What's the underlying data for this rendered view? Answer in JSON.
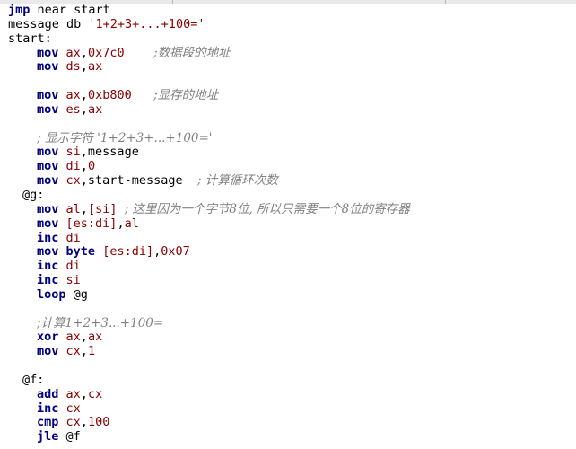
{
  "code": {
    "l1": {
      "kw": "jmp",
      "rest": " near start"
    },
    "l2": {
      "a": "message db ",
      "str": "'1+2+3+...+100='"
    },
    "l3": {
      "label": "start:"
    },
    "l4": {
      "kw": "mov",
      "sp": " ",
      "reg": "ax",
      "sep": ",",
      "num": "0x7c0",
      "gap": "    ",
      "cmt": ";数据段的地址"
    },
    "l5": {
      "kw": "mov",
      "sp": " ",
      "reg1": "ds",
      "sep": ",",
      "reg2": "ax"
    },
    "l7": {
      "kw": "mov",
      "sp": " ",
      "reg": "ax",
      "sep": ",",
      "num": "0xb800",
      "gap": "   ",
      "cmt": ";显存的地址"
    },
    "l8": {
      "kw": "mov",
      "sp": " ",
      "reg1": "es",
      "sep": ",",
      "reg2": "ax"
    },
    "l10": {
      "cmt": "; 显示字符 '1+2+3+...+100='"
    },
    "l11": {
      "kw": "mov",
      "sp": " ",
      "reg": "si",
      "rest": ",message"
    },
    "l12": {
      "kw": "mov",
      "sp": " ",
      "reg": "di",
      "sep": ",",
      "num": "0"
    },
    "l13": {
      "kw": "mov",
      "sp": " ",
      "reg": "cx",
      "rest": ",start-message",
      "gap": "  ",
      "cmt": "; 计算循环次数"
    },
    "l14": {
      "label": "@g:"
    },
    "l15": {
      "kw": "mov",
      "sp": " ",
      "reg": "al",
      "sep": ",",
      "mem": "[si]",
      "gap": " ",
      "cmt": "; 这里因为一个字节8位, 所以只需要一个8位的寄存器"
    },
    "l16": {
      "kw": "mov",
      "sp": " ",
      "mem": "[es:di]",
      "sep": ",",
      "reg": "al"
    },
    "l17": {
      "kw": "inc",
      "sp": " ",
      "reg": "di"
    },
    "l18": {
      "kw": "mov",
      "sp": " ",
      "kw2": "byte",
      "sp2": " ",
      "mem": "[es:di]",
      "sep": ",",
      "num": "0x07"
    },
    "l19": {
      "kw": "inc",
      "sp": " ",
      "reg": "di"
    },
    "l20": {
      "kw": "inc",
      "sp": " ",
      "reg": "si"
    },
    "l21": {
      "kw": "loop",
      "rest": " @g"
    },
    "l23": {
      "cmt": ";计算1+2+3...+100="
    },
    "l24": {
      "kw": "xor",
      "sp": " ",
      "reg1": "ax",
      "sep": ",",
      "reg2": "ax"
    },
    "l25": {
      "kw": "mov",
      "sp": " ",
      "reg": "cx",
      "sep": ",",
      "num": "1"
    },
    "l27": {
      "label": "@f:"
    },
    "l28": {
      "kw": "add",
      "sp": " ",
      "reg1": "ax",
      "sep": ",",
      "reg2": "cx"
    },
    "l29": {
      "kw": "inc",
      "sp": " ",
      "reg": "cx"
    },
    "l30": {
      "kw": "cmp",
      "sp": " ",
      "reg": "cx",
      "sep": ",",
      "num": "100"
    },
    "l31": {
      "kw": "jle",
      "rest": " @f"
    }
  }
}
